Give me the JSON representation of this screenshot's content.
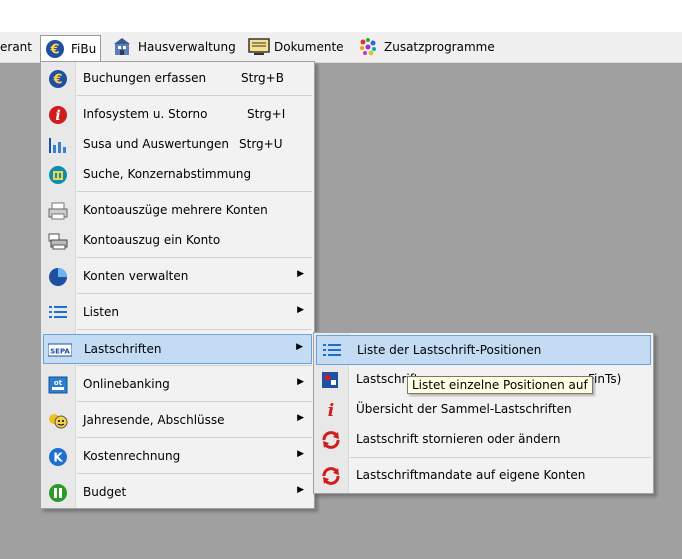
{
  "menubar": {
    "items": [
      {
        "label": "erant",
        "icon": "none"
      },
      {
        "label": "FiBu",
        "icon": "euro-icon"
      },
      {
        "label": "Hausverwaltung",
        "icon": "building-icon"
      },
      {
        "label": "Dokumente",
        "icon": "document-monitor-icon"
      },
      {
        "label": "Zusatzprogramme",
        "icon": "dots-icon"
      }
    ]
  },
  "fibu_menu": {
    "items": [
      {
        "label": "Buchungen erfassen",
        "shortcut": "Strg+B",
        "icon": "euro-icon"
      },
      {
        "label": "Infosystem u. Storno",
        "shortcut": "Strg+I",
        "icon": "info-icon"
      },
      {
        "label": "Susa und Auswertungen",
        "shortcut": "Strg+U",
        "icon": "bar-chart-icon"
      },
      {
        "label": "Suche, Konzernabstimmung",
        "shortcut": "",
        "icon": "search-building-icon"
      },
      {
        "label": "Kontoauszüge mehrere Konten",
        "shortcut": "",
        "icon": "printer-icon"
      },
      {
        "label": "Kontoauszug ein Konto",
        "shortcut": "",
        "icon": "printer-stack-icon"
      },
      {
        "label": "Konten verwalten",
        "shortcut": "",
        "icon": "pie-icon",
        "submenu": true
      },
      {
        "label": "Listen",
        "shortcut": "",
        "icon": "list-icon",
        "submenu": true
      },
      {
        "label": "Lastschriften",
        "shortcut": "",
        "icon": "sepa-icon",
        "submenu": true
      },
      {
        "label": "Onlinebanking",
        "shortcut": "",
        "icon": "online-banking-icon",
        "submenu": true
      },
      {
        "label": "Jahresende, Abschlüsse",
        "shortcut": "",
        "icon": "year-end-icon",
        "submenu": true
      },
      {
        "label": "Kostenrechnung",
        "shortcut": "",
        "icon": "k-circle-icon",
        "submenu": true
      },
      {
        "label": "Budget",
        "shortcut": "",
        "icon": "budget-icon",
        "submenu": true
      }
    ]
  },
  "lastschriften_menu": {
    "items": [
      {
        "label": "Liste der Lastschrift-Positionen",
        "icon": "list-icon"
      },
      {
        "label": "Lastschrift",
        "label_tail": "FinTs)",
        "icon": "bank-transfer-icon"
      },
      {
        "label": "Übersicht der Sammel-Lastschriften",
        "icon": "info-icon"
      },
      {
        "label": "Lastschrift stornieren oder ändern",
        "icon": "refresh-icon"
      },
      {
        "label": "Lastschriftmandate auf eigene Konten",
        "icon": "refresh-icon"
      }
    ]
  },
  "tooltip": {
    "text": "Listet einzelne Positionen auf"
  },
  "colors": {
    "desktop": "#a0a0a0",
    "highlight": "#c3dcf4",
    "highlight_border": "#6fa2d8",
    "tooltip_bg": "#ffffe1"
  }
}
